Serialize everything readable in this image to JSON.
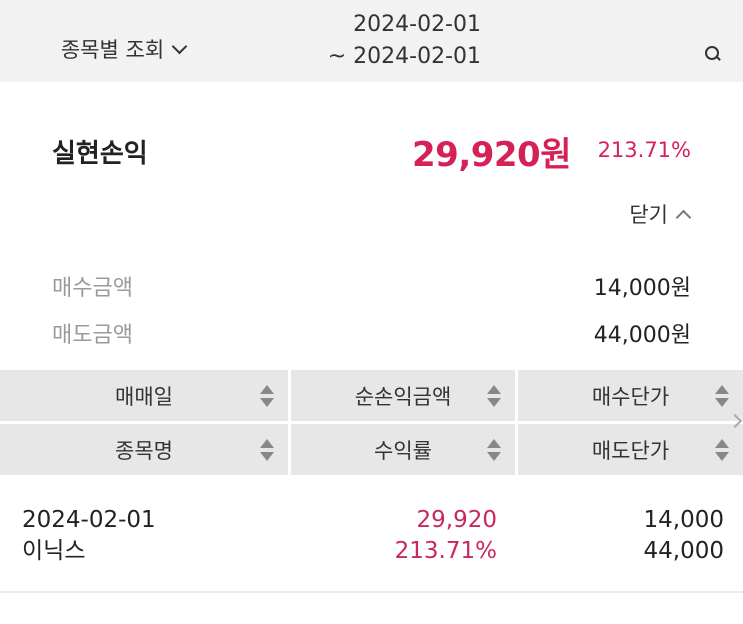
{
  "filter": {
    "stock_view_label": "종목별 조회",
    "date_from": "2024-02-01",
    "date_to": "~ 2024-02-01"
  },
  "summary": {
    "title": "실현손익",
    "amount": "29,920원",
    "rate": "213.71%",
    "close_label": "닫기",
    "buy_label": "매수금액",
    "buy_value": "14,000원",
    "sell_label": "매도금액",
    "sell_value": "44,000원"
  },
  "table": {
    "headers": {
      "trade_date": "매매일",
      "net_profit": "순손익금액",
      "buy_price": "매수단가",
      "stock_name": "종목명",
      "return_rate": "수익률",
      "sell_price": "매도단가"
    },
    "rows": [
      {
        "trade_date": "2024-02-01",
        "stock_name": "이닉스",
        "net_profit": "29,920",
        "return_rate": "213.71%",
        "buy_price": "14,000",
        "sell_price": "44,000"
      }
    ]
  },
  "colors": {
    "profit": "#d42156",
    "header_bg": "#e7e7e7",
    "filter_bg": "#f2f2f2"
  }
}
